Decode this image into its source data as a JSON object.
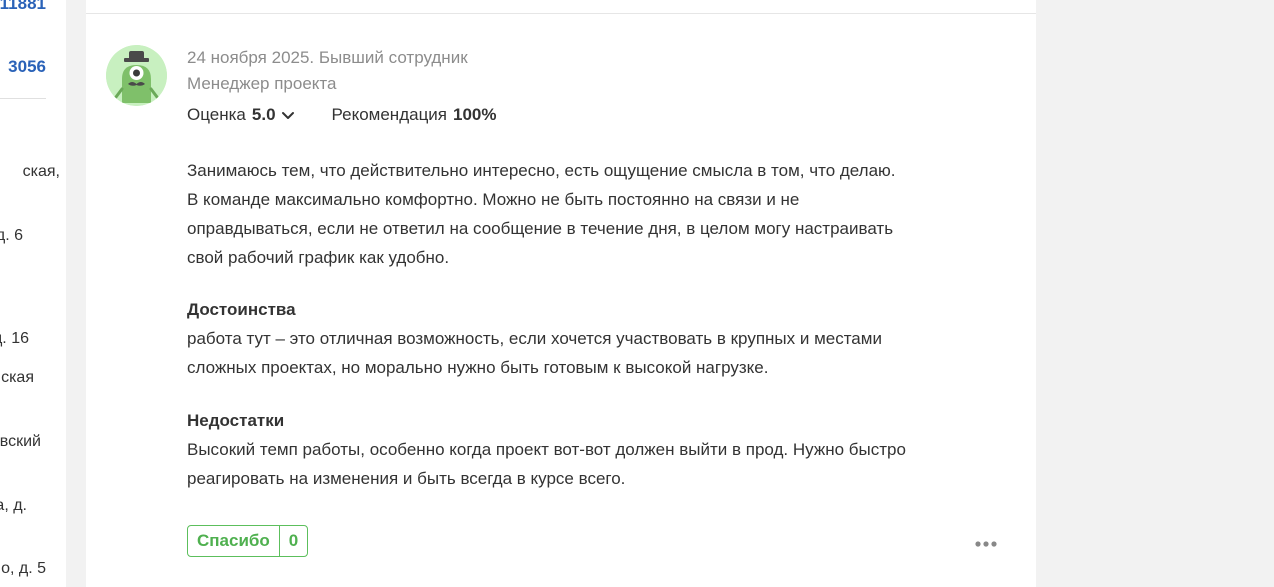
{
  "left_column": {
    "links": [
      "11881",
      "3056"
    ],
    "address_fragments": [
      "ская,",
      "д. 6",
      "д. 16",
      "ская",
      "вский",
      "а, д.",
      "о, д. 5"
    ]
  },
  "review": {
    "date_status": "24 ноября 2025. Бывший сотрудник",
    "position": "Менеджер проекта",
    "rating_label": "Оценка",
    "rating_value": "5.0",
    "recommendation_label": "Рекомендация",
    "recommendation_value": "100%",
    "body": "Занимаюсь тем, что действительно интересно, есть ощущение смысла в том, что делаю. В команде максимально комфортно. Можно не быть постоянно на связи и не оправдываться, если не ответил на сообщение в течение дня, в целом могу настраивать свой рабочий график как удобно.",
    "pros_title": "Достоинства",
    "pros_text": "работа тут – это отличная возможность, если хочется участвовать в крупных и местами сложных проектах, но морально нужно быть готовым к высокой нагрузке.",
    "cons_title": "Недостатки",
    "cons_text": "Высокий темп работы, особенно когда проект вот-вот должен выйти в прод. Нужно быстро реагировать на изменения и быть всегда в курсе всего.",
    "thanks_label": "Спасибо",
    "thanks_count": "0"
  },
  "colors": {
    "link_blue": "#2a62b8",
    "accent_green": "#4fb04f",
    "muted_gray": "#8c8c8c",
    "avatar_bg": "#c8f0c0"
  },
  "icons": {
    "avatar": "monster-avatar-icon",
    "rating_toggle": "chevron-down-icon",
    "more": "more-dots-icon"
  }
}
